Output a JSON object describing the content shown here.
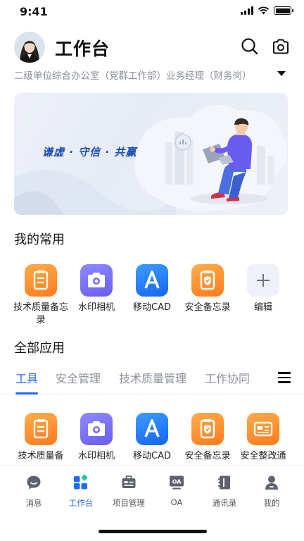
{
  "status_bar": {
    "time": "9:41"
  },
  "header": {
    "title": "工作台",
    "org": "二级单位综合办公室（党群工作部）业务经理（财务岗）"
  },
  "banner": {
    "slogan": "谦虚 · 守信 · 共赢"
  },
  "favorites": {
    "title": "我的常用",
    "items": [
      {
        "label": "技术质量备忘录",
        "icon": "memo-icon"
      },
      {
        "label": "水印相机",
        "icon": "camera-icon"
      },
      {
        "label": "移动CAD",
        "icon": "cad-a-icon"
      },
      {
        "label": "安全备忘录",
        "icon": "shield-memo-icon"
      },
      {
        "label": "编辑",
        "icon": "plus-icon"
      }
    ]
  },
  "all_apps": {
    "title": "全部应用",
    "tabs": [
      {
        "label": "工具"
      },
      {
        "label": "安全管理"
      },
      {
        "label": "技术质量管理"
      },
      {
        "label": "工作协同"
      }
    ],
    "items": [
      {
        "label": "技术质量备",
        "icon": "memo-icon"
      },
      {
        "label": "水印相机",
        "icon": "camera-icon"
      },
      {
        "label": "移动CAD",
        "icon": "cad-a-icon"
      },
      {
        "label": "安全备忘录",
        "icon": "shield-memo-icon"
      },
      {
        "label": "安全整改通",
        "icon": "rectification-icon"
      }
    ]
  },
  "bottom_nav": [
    {
      "label": "消息",
      "icon": "message-icon"
    },
    {
      "label": "工作台",
      "icon": "workbench-icon",
      "active": true
    },
    {
      "label": "项目管理",
      "icon": "project-icon"
    },
    {
      "label": "OA",
      "icon": "oa-icon"
    },
    {
      "label": "通讯录",
      "icon": "contacts-icon"
    },
    {
      "label": "我的",
      "icon": "profile-icon"
    }
  ],
  "colors": {
    "accent": "#1f6bff",
    "orange": "#ff8a24",
    "purple": "#7468f5",
    "blue": "#1a73f2"
  }
}
